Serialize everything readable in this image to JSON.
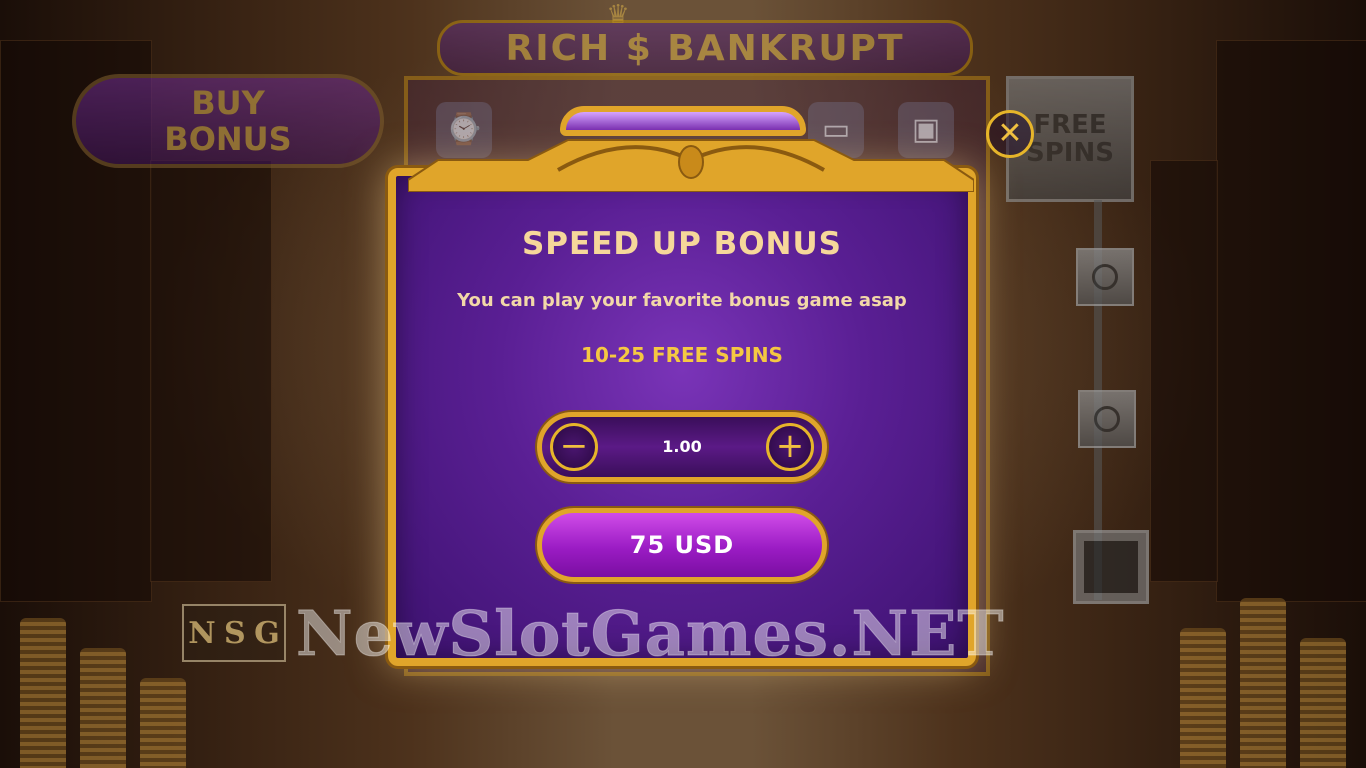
{
  "game": {
    "logo_text": "RICH $ BANKRUPT",
    "buy_bonus_label": "BUY\nBONUS",
    "free_spins_label": "FREE\nSPINS"
  },
  "dialog": {
    "title": "SPEED UP BONUS",
    "description": "You can play your favorite bonus game asap",
    "spins_range": "10-25 FREE SPINS",
    "bet_value": "1.00",
    "minus_symbol": "−",
    "plus_symbol": "+",
    "price_label": "75 USD",
    "close_symbol": "✕"
  },
  "watermark": {
    "letters": [
      "N",
      "S",
      "G"
    ],
    "text": "NewSlotGames.NET"
  },
  "colors": {
    "gold": "#e0a52a",
    "purple": "#5a1f94",
    "title": "#f6d79a",
    "spins": "#f5c842"
  }
}
